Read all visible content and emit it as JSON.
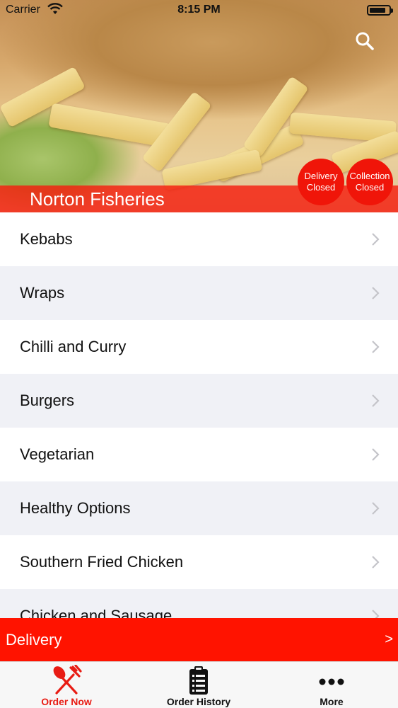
{
  "status_bar": {
    "carrier": "Carrier",
    "time": "8:15 PM"
  },
  "hero": {
    "restaurant_name": "Norton Fisheries",
    "delivery_badge": [
      "Delivery",
      "Closed"
    ],
    "collection_badge": [
      "Collection",
      "Closed"
    ],
    "search_icon": "search-icon"
  },
  "menu": {
    "categories": [
      "Kebabs",
      "Wraps",
      "Chilli and Curry",
      "Burgers",
      "Vegetarian",
      "Healthy Options",
      "Southern Fried Chicken",
      "Chicken and Sausage"
    ]
  },
  "delivery_bar": {
    "label": "Delivery",
    "arrow": ">"
  },
  "tabbar": {
    "tabs": [
      {
        "label": "Order Now",
        "icon": "fork-knife-icon",
        "active": true
      },
      {
        "label": "Order History",
        "icon": "clipboard-list-icon",
        "active": false
      },
      {
        "label": "More",
        "icon": "more-dots-icon",
        "active": false
      }
    ]
  },
  "colors": {
    "accent": "#ff1300",
    "badge": "#f01509",
    "row_alt": "#f0f1f6"
  }
}
